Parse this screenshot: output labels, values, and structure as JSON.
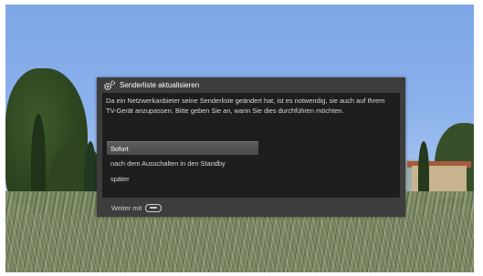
{
  "dialog": {
    "title": "Senderliste aktualisieren",
    "title_icon": "gear-icon",
    "message": "Da ein Netzwerkanbieter seine Senderliste geändert hat, ist es notwendig, sie auch auf Ihrem TV-Gerät anzupassen. Bitte geben Sie an, wann Sie dies durchführen möchten.",
    "options": [
      {
        "label": "Sofort",
        "selected": true
      },
      {
        "label": "nach dem Ausschalten in den Standby",
        "selected": false
      },
      {
        "label": "später",
        "selected": false
      }
    ],
    "footer_text": "Weiter mit",
    "footer_icon": "ok-button-icon"
  },
  "colors": {
    "dialog_frame": "#3d3d3d",
    "dialog_body": "#1e1e1e",
    "selection": "#5c5c5c"
  }
}
